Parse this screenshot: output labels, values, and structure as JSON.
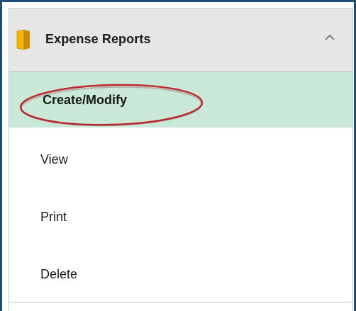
{
  "section": {
    "title": "Expense Reports",
    "icon": "folder-icon",
    "toggle_icon": "chevron-up-icon",
    "expanded": true
  },
  "menu": {
    "items": [
      {
        "label": "Create/Modify",
        "selected": true
      },
      {
        "label": "View",
        "selected": false
      },
      {
        "label": "Print",
        "selected": false
      },
      {
        "label": "Delete",
        "selected": false
      }
    ]
  },
  "colors": {
    "frame_border": "#1f4e79",
    "header_bg": "#e6e6e6",
    "selected_bg": "#c9e8d8",
    "folder_icon": "#e3a600",
    "annotation": "#c0262d"
  },
  "annotation": {
    "shape": "oval",
    "target": "Create/Modify"
  }
}
